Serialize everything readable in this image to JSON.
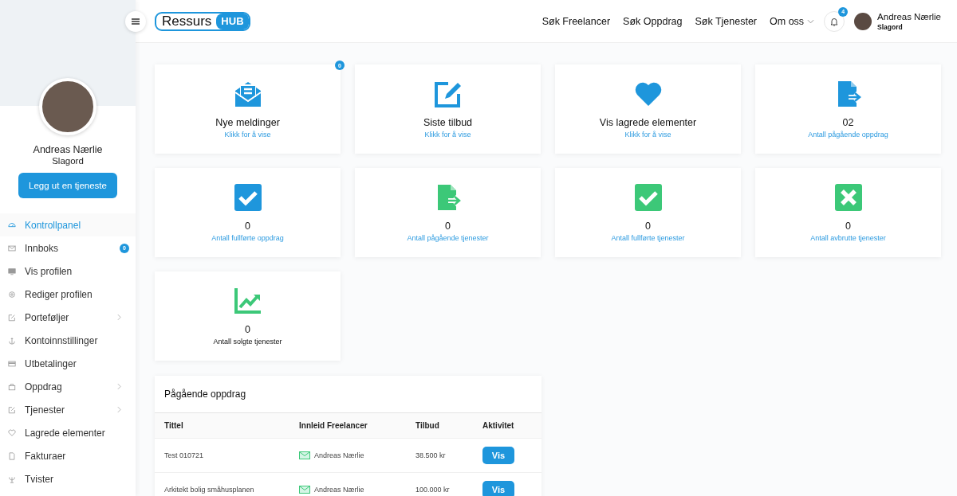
{
  "header": {
    "logo": {
      "word": "Ressurs",
      "tag": "HUB"
    },
    "nav": [
      {
        "label": "Søk Freelancer",
        "dropdown": false
      },
      {
        "label": "Søk Oppdrag",
        "dropdown": false
      },
      {
        "label": "Søk Tjenester",
        "dropdown": false
      },
      {
        "label": "Om oss",
        "dropdown": true
      }
    ],
    "notifications": {
      "count": "4"
    },
    "user": {
      "name": "Andreas Nærlie",
      "tagline": "Slagord"
    }
  },
  "sidebar": {
    "profile": {
      "name": "Andreas Nærlie",
      "tagline": "Slagord"
    },
    "button": "Legg ut en tjeneste",
    "items": [
      {
        "kind": "dashboard",
        "label": "Kontrollpanel",
        "selected": true,
        "submenu": false
      },
      {
        "kind": "mail",
        "label": "Innboks",
        "selected": false,
        "submenu": false,
        "badge": "0"
      },
      {
        "kind": "monitor",
        "label": "Vis profilen",
        "selected": false,
        "submenu": false
      },
      {
        "kind": "gear",
        "label": "Rediger profilen",
        "selected": false,
        "submenu": false
      },
      {
        "kind": "edit",
        "label": "Porteføljer",
        "selected": false,
        "submenu": true
      },
      {
        "kind": "anchor",
        "label": "Kontoinnstillinger",
        "selected": false,
        "submenu": false
      },
      {
        "kind": "card",
        "label": "Utbetalinger",
        "selected": false,
        "submenu": false
      },
      {
        "kind": "bag",
        "label": "Oppdrag",
        "selected": false,
        "submenu": true
      },
      {
        "kind": "edit",
        "label": "Tjenester",
        "selected": false,
        "submenu": true
      },
      {
        "kind": "heart",
        "label": "Lagrede elementer",
        "selected": false,
        "submenu": false
      },
      {
        "kind": "file",
        "label": "Fakturaer",
        "selected": false,
        "submenu": false
      },
      {
        "kind": "trident",
        "label": "Tvister",
        "selected": false,
        "submenu": false
      }
    ]
  },
  "cards": [
    {
      "kind": "envelope",
      "color": "#1e96dc",
      "title": "Nye meldinger",
      "subtitle": "Klikk for å vise",
      "link": true,
      "badge": "0"
    },
    {
      "kind": "edit",
      "color": "#1e96dc",
      "title": "Siste tilbud",
      "subtitle": "Klikk for å vise",
      "link": true
    },
    {
      "kind": "heart",
      "color": "#1e96dc",
      "title": "Vis lagrede elementer",
      "subtitle": "Klikk for å vise",
      "link": true
    },
    {
      "kind": "file-arrow",
      "color": "#1e96dc",
      "title": "02",
      "subtitle": "Antall pågående oppdrag",
      "link": true
    },
    {
      "kind": "check",
      "color": "#1e96dc",
      "title": "0",
      "subtitle": "Antall fullførte oppdrag",
      "link": true
    },
    {
      "kind": "file-arrow",
      "color": "#3cc878",
      "title": "0",
      "subtitle": "Antall pågående tjenester",
      "link": true
    },
    {
      "kind": "check",
      "color": "#3cc878",
      "title": "0",
      "subtitle": "Antall fullførte tjenester",
      "link": true
    },
    {
      "kind": "cross",
      "color": "#3cc878",
      "title": "0",
      "subtitle": "Antall avbrutte tjenester",
      "link": true
    },
    {
      "kind": "chart",
      "color": "#3cc878",
      "title": "0",
      "subtitle": "Antall solgte tjenester",
      "link": false
    }
  ],
  "table": {
    "title": "Pågående oppdrag",
    "columns": [
      "Tittel",
      "Innleid Freelancer",
      "Tilbud",
      "Aktivitet"
    ],
    "rows": [
      {
        "title": "Test 010721",
        "freelancer": "Andreas Nærlie",
        "offer": "38.500 kr",
        "action": "Vis"
      },
      {
        "title": "Arkitekt bolig småhusplanen",
        "freelancer": "Andreas Nærlie",
        "offer": "100.000 kr",
        "action": "Vis"
      }
    ]
  }
}
